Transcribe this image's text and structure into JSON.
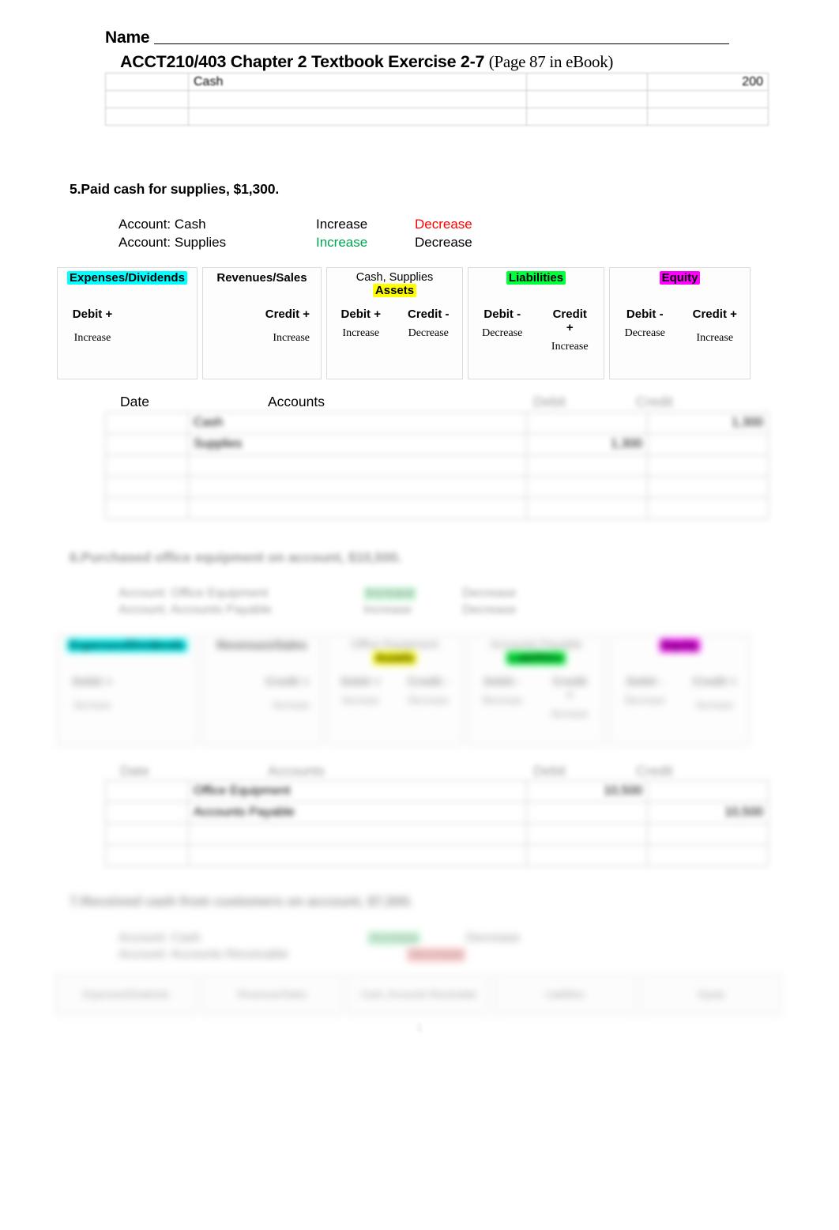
{
  "header": {
    "name_label": "Name",
    "title_main": "ACCT210/403 Chapter 2 Textbook Exercise 2-7",
    "title_paren": "(Page 87 in eBook)"
  },
  "top_table": {
    "rows": [
      {
        "date": "",
        "account": "Cash",
        "debit": "",
        "credit": "200"
      },
      {
        "date": "",
        "account": "",
        "debit": "",
        "credit": ""
      },
      {
        "date": "",
        "account": "",
        "debit": "",
        "credit": ""
      }
    ]
  },
  "section5": {
    "question": "5.Paid cash for supplies, $1,300.",
    "accounts": [
      {
        "label": "Account: Cash",
        "increase": "Increase",
        "decrease": "Decrease",
        "increase_color": "#000000",
        "decrease_color": "#ff0000"
      },
      {
        "label": "Account: Supplies",
        "increase": "Increase",
        "decrease": "Decrease",
        "increase_color": "#00a550",
        "decrease_color": "#000000"
      }
    ],
    "diagram": {
      "boxes": [
        {
          "memo": "",
          "category": "Expenses/Dividends",
          "highlight": "#00ffff",
          "columns": [
            {
              "dc": "Debit +",
              "effect": "Increase"
            },
            {
              "dc": "",
              "effect": ""
            }
          ]
        },
        {
          "memo": "",
          "category": "Revenues/Sales",
          "highlight": "",
          "columns": [
            {
              "dc": "",
              "effect": ""
            },
            {
              "dc": "Credit +",
              "effect": "Increase"
            }
          ]
        },
        {
          "memo": "Cash, Supplies",
          "category": "Assets",
          "highlight": "#ffff00",
          "columns": [
            {
              "dc": "Debit +",
              "effect": "Increase"
            },
            {
              "dc": "Credit -",
              "effect": "Decrease"
            }
          ]
        },
        {
          "memo": "",
          "category": "Liabilities",
          "highlight": "#00ff3c",
          "columns": [
            {
              "dc": "Debit -",
              "effect": "Decrease"
            },
            {
              "dc": "Credit +",
              "effect": "Increase"
            }
          ]
        },
        {
          "memo": "",
          "category": "Equity",
          "highlight": "#ff00ff",
          "columns": [
            {
              "dc": "Debit -",
              "effect": "Decrease"
            },
            {
              "dc": "Credit +",
              "effect": "Increase"
            }
          ]
        }
      ]
    },
    "journal": {
      "col_date": "Date",
      "col_accounts": "Accounts",
      "col_debit": "Debit",
      "col_credit": "Credit",
      "rows": [
        {
          "date": "",
          "account": "Cash",
          "debit": "",
          "credit": "1,300"
        },
        {
          "date": "",
          "account": "Supplies",
          "debit": "1,300",
          "credit": ""
        },
        {
          "date": "",
          "account": "",
          "debit": "",
          "credit": ""
        },
        {
          "date": "",
          "account": "",
          "debit": "",
          "credit": ""
        },
        {
          "date": "",
          "account": "",
          "debit": "",
          "credit": ""
        }
      ]
    }
  },
  "section6": {
    "question": "6.Purchased office equipment on account, $10,500.",
    "accounts": [
      {
        "label": "Account: Office Equipment",
        "increase": "Increase",
        "decrease": "Decrease"
      },
      {
        "label": "Account: Accounts Payable",
        "increase": "Increase",
        "decrease": "Decrease"
      }
    ],
    "diagram": {
      "boxes": [
        {
          "memo": "",
          "category": "Expenses/Dividends",
          "highlight": "#00ffff",
          "columns": [
            {
              "dc": "Debit +",
              "effect": "Increase"
            },
            {
              "dc": "",
              "effect": ""
            }
          ]
        },
        {
          "memo": "",
          "category": "Revenues/Sales",
          "highlight": "",
          "columns": [
            {
              "dc": "",
              "effect": ""
            },
            {
              "dc": "Credit +",
              "effect": "Increase"
            }
          ]
        },
        {
          "memo": "Office Equipment",
          "category": "Assets",
          "highlight": "#ffff00",
          "columns": [
            {
              "dc": "Debit +",
              "effect": "Increase"
            },
            {
              "dc": "Credit -",
              "effect": "Decrease"
            }
          ]
        },
        {
          "memo": "Accounts Payable",
          "category": "Liabilities",
          "highlight": "#00ff3c",
          "columns": [
            {
              "dc": "Debit -",
              "effect": "Decrease"
            },
            {
              "dc": "Credit +",
              "effect": "Increase"
            }
          ]
        },
        {
          "memo": "",
          "category": "Equity",
          "highlight": "#ff00ff",
          "columns": [
            {
              "dc": "Debit -",
              "effect": "Decrease"
            },
            {
              "dc": "Credit +",
              "effect": "Increase"
            }
          ]
        }
      ]
    },
    "journal": {
      "col_date": "Date",
      "col_accounts": "Accounts",
      "col_debit": "Debit",
      "col_credit": "Credit",
      "rows": [
        {
          "date": "",
          "account": "Office Equipment",
          "debit": "10,500",
          "credit": ""
        },
        {
          "date": "",
          "account": "Accounts Payable",
          "debit": "",
          "credit": "10,500"
        },
        {
          "date": "",
          "account": "",
          "debit": "",
          "credit": ""
        },
        {
          "date": "",
          "account": "",
          "debit": "",
          "credit": ""
        }
      ]
    }
  },
  "section7": {
    "question": "7.Received cash from customers on account, $7,500.",
    "accounts": [
      {
        "label": "Account: Cash",
        "increase": "Increase",
        "decrease": "Decrease"
      },
      {
        "label": "Account: Accounts Receivable",
        "increase": "Increase",
        "decrease": "Decrease"
      }
    ],
    "diagram": {
      "boxes": [
        {
          "memo": "",
          "category": "Expenses/Dividends",
          "highlight": ""
        },
        {
          "memo": "",
          "category": "Revenues/Sales",
          "highlight": ""
        },
        {
          "memo": "Cash, Accounts Receivable",
          "category": "Assets",
          "highlight": ""
        },
        {
          "memo": "",
          "category": "Liabilities",
          "highlight": ""
        },
        {
          "memo": "",
          "category": "Equity",
          "highlight": ""
        }
      ]
    }
  },
  "footer": {
    "page_number": "1"
  }
}
